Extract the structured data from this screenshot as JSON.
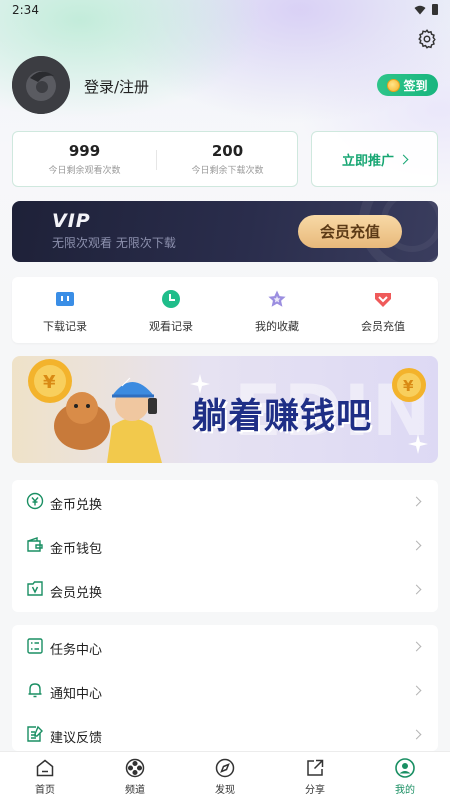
{
  "status_bar": {
    "time": "2:34"
  },
  "profile": {
    "login_label": "登录/注册",
    "checkin_label": "签到"
  },
  "stats": {
    "watch": {
      "value": "999",
      "label": "今日剩余观看次数"
    },
    "download": {
      "value": "200",
      "label": "今日剩余下载次数"
    }
  },
  "promote": {
    "label": "立即推广"
  },
  "vip_banner": {
    "logo": "VIP",
    "subtitle": "无限次观看  无限次下载",
    "button": "会员充值"
  },
  "quick_actions": [
    {
      "label": "下载记录",
      "icon": "download-record-icon",
      "color": "#3a8ee6"
    },
    {
      "label": "观看记录",
      "icon": "watch-history-icon",
      "color": "#1fbd8a"
    },
    {
      "label": "我的收藏",
      "icon": "favorite-star-icon",
      "color": "#9b8ee0"
    },
    {
      "label": "会员充值",
      "icon": "vip-recharge-icon",
      "color": "#ef5a5a"
    }
  ],
  "promo_banner": {
    "text": "躺着赚钱吧",
    "bg_letters": "EDIN"
  },
  "menu_group_1": [
    {
      "label": "金币兑换",
      "icon": "coin-exchange-icon"
    },
    {
      "label": "金币钱包",
      "icon": "wallet-icon"
    },
    {
      "label": "会员兑换",
      "icon": "vip-exchange-icon"
    }
  ],
  "menu_group_2": [
    {
      "label": "任务中心",
      "icon": "task-center-icon"
    },
    {
      "label": "通知中心",
      "icon": "bell-icon"
    },
    {
      "label": "建议反馈",
      "icon": "feedback-icon"
    }
  ],
  "tabs": [
    {
      "label": "首页",
      "icon": "home-icon"
    },
    {
      "label": "频道",
      "icon": "channel-icon"
    },
    {
      "label": "发现",
      "icon": "compass-icon"
    },
    {
      "label": "分享",
      "icon": "share-icon"
    },
    {
      "label": "我的",
      "icon": "profile-icon",
      "active": true
    }
  ],
  "colors": {
    "accent": "#1a8f63",
    "vip_dark": "#1e2138",
    "promo_text": "#1f2f86"
  }
}
